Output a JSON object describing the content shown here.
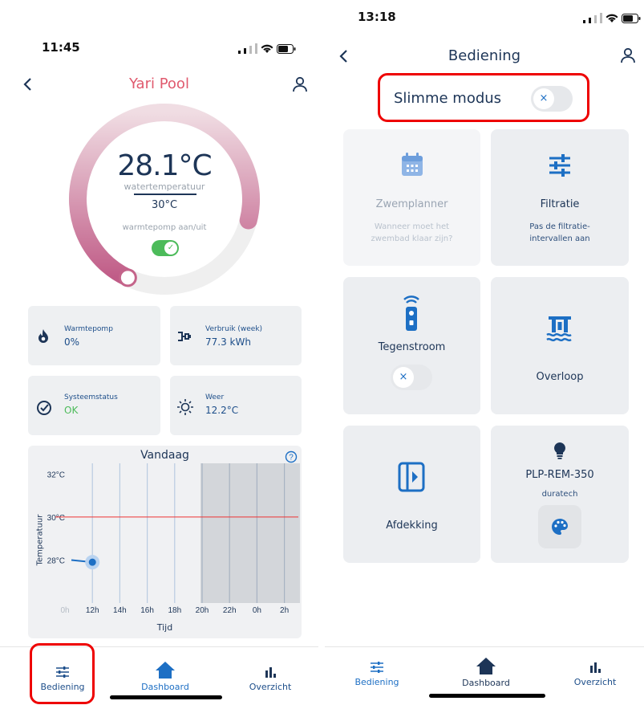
{
  "left": {
    "time": "11:45",
    "title": "Yari Pool",
    "gauge": {
      "temperature": "28.1°C",
      "temperature_label": "watertemperatuur",
      "target": "30°C",
      "heatpump_label": "warmtepomp aan/uit",
      "heatpump_on": true,
      "progress_fraction": 0.72
    },
    "cards": {
      "heatpump": {
        "label": "Warmtepomp",
        "value": "0%"
      },
      "usage": {
        "label": "Verbruik (week)",
        "value": "77.3 kWh"
      },
      "status": {
        "label": "Systeemstatus",
        "value": "OK"
      },
      "weather": {
        "label": "Weer",
        "value": "12.2°C"
      }
    },
    "nav": {
      "bediening": "Bediening",
      "dashboard": "Dashboard",
      "overzicht": "Overzicht"
    }
  },
  "chart_data": {
    "type": "line",
    "title": "Vandaag",
    "xlabel": "Tijd",
    "ylabel": "Temperatuur",
    "x_ticks": [
      "0h",
      "12h",
      "14h",
      "16h",
      "18h",
      "20h",
      "22h",
      "0h",
      "2h"
    ],
    "y_ticks": [
      "32°C",
      "30°C",
      "28°C"
    ],
    "ylim": [
      26,
      32.5
    ],
    "target_line": {
      "value": 30
    },
    "series": [
      {
        "x": [
          "0h",
          "12h"
        ],
        "values": [
          28,
          27.9
        ]
      }
    ],
    "shaded_from": "20h"
  },
  "right": {
    "time": "13:18",
    "title": "Bediening",
    "smart_mode_label": "Slimme modus",
    "tiles": {
      "zwemplanner": {
        "label": "Zwemplanner",
        "sub1": "Wanneer moet het",
        "sub2": "zwembad klaar zijn?"
      },
      "filtratie": {
        "label": "Filtratie",
        "sub1": "Pas de filtratie-",
        "sub2": "intervallen aan"
      },
      "tegenstroom": {
        "label": "Tegenstroom"
      },
      "overloop": {
        "label": "Overloop"
      },
      "afdekking": {
        "label": "Afdekking"
      },
      "lamp": {
        "label": "PLP-REM-350",
        "sub": "duratech"
      }
    },
    "toggle_off_symbol": "×",
    "nav": {
      "bediening": "Bediening",
      "dashboard": "Dashboard",
      "overzicht": "Overzicht"
    }
  },
  "colors": {
    "accent": "#1d6fc4",
    "title_pink": "#e05a6e",
    "gauge": "#c4648a",
    "green": "#4cbb5a",
    "red_target": "#e33"
  }
}
